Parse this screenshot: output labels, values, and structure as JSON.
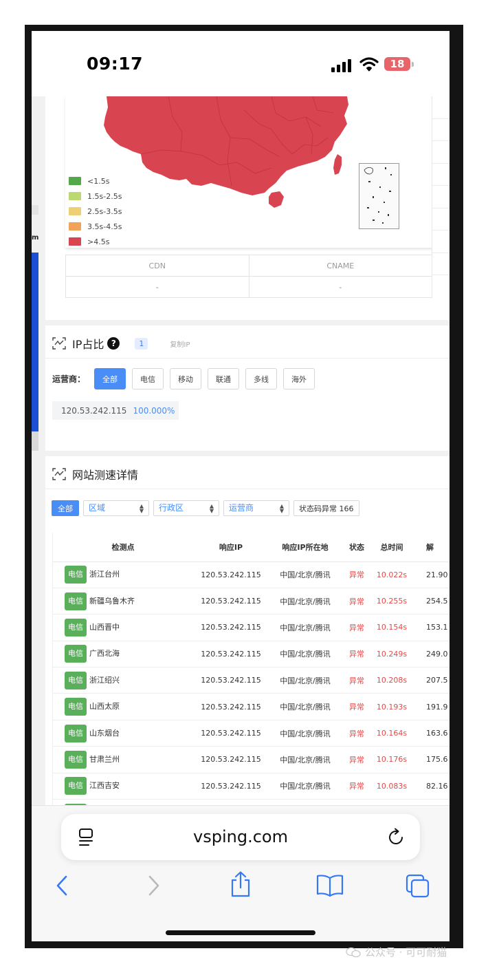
{
  "status": {
    "time": "09:17",
    "battery": "18"
  },
  "map": {
    "legend": [
      {
        "label": "<1.5s",
        "color": "#55a84a"
      },
      {
        "label": "1.5s-2.5s",
        "color": "#bcd870"
      },
      {
        "label": "2.5s-3.5s",
        "color": "#efcf73"
      },
      {
        "label": "3.5s-4.5s",
        "color": "#f2a35a"
      },
      {
        "label": ">4.5s",
        "color": "#d8444f"
      }
    ],
    "fill_color": "#d8444f"
  },
  "cdn_table": {
    "headers": [
      "CDN",
      "CNAME"
    ],
    "row": [
      "-",
      "-"
    ]
  },
  "left_peek_text": "m",
  "ip_card": {
    "title": "IP占比",
    "help": "?",
    "count": "1",
    "copy": "复制IP",
    "isp_label": "运营商：",
    "isp_buttons": [
      "全部",
      "电信",
      "移动",
      "联通",
      "多线",
      "海外"
    ],
    "ip": "120.53.242.115",
    "percent": "100.000%"
  },
  "detail_card": {
    "title": "网站测速详情",
    "filter_all": "全部",
    "filters": [
      "区域",
      "行政区",
      "运营商"
    ],
    "status_filter": "状态码异常  166",
    "columns": [
      "检测点",
      "响应IP",
      "响应IP所在地",
      "状态",
      "总时间",
      "解"
    ],
    "rows": [
      {
        "isp": "电信",
        "location": "浙江台州",
        "ip": "120.53.242.115",
        "ip_loc": "中国/北京/腾讯",
        "status": "异常",
        "time": "10.022s",
        "dns": "21.90"
      },
      {
        "isp": "电信",
        "location": "新疆乌鲁木齐",
        "ip": "120.53.242.115",
        "ip_loc": "中国/北京/腾讯",
        "status": "异常",
        "time": "10.255s",
        "dns": "254.5"
      },
      {
        "isp": "电信",
        "location": "山西晋中",
        "ip": "120.53.242.115",
        "ip_loc": "中国/北京/腾讯",
        "status": "异常",
        "time": "10.154s",
        "dns": "153.1"
      },
      {
        "isp": "电信",
        "location": "广西北海",
        "ip": "120.53.242.115",
        "ip_loc": "中国/北京/腾讯",
        "status": "异常",
        "time": "10.249s",
        "dns": "249.0"
      },
      {
        "isp": "电信",
        "location": "浙江绍兴",
        "ip": "120.53.242.115",
        "ip_loc": "中国/北京/腾讯",
        "status": "异常",
        "time": "10.208s",
        "dns": "207.5"
      },
      {
        "isp": "电信",
        "location": "山西太原",
        "ip": "120.53.242.115",
        "ip_loc": "中国/北京/腾讯",
        "status": "异常",
        "time": "10.193s",
        "dns": "191.9"
      },
      {
        "isp": "电信",
        "location": "山东烟台",
        "ip": "120.53.242.115",
        "ip_loc": "中国/北京/腾讯",
        "status": "异常",
        "time": "10.164s",
        "dns": "163.6"
      },
      {
        "isp": "电信",
        "location": "甘肃兰州",
        "ip": "120.53.242.115",
        "ip_loc": "中国/北京/腾讯",
        "status": "异常",
        "time": "10.176s",
        "dns": "175.6"
      },
      {
        "isp": "电信",
        "location": "江西吉安",
        "ip": "120.53.242.115",
        "ip_loc": "中国/北京/腾讯",
        "status": "异常",
        "time": "10.083s",
        "dns": "82.16"
      },
      {
        "isp": "电信",
        "location": "",
        "ip": "",
        "ip_loc": "",
        "status": "",
        "time": "",
        "dns": ""
      }
    ]
  },
  "browser": {
    "url": "vsping.com"
  },
  "watermark": "公众号 · 可可耐猫"
}
